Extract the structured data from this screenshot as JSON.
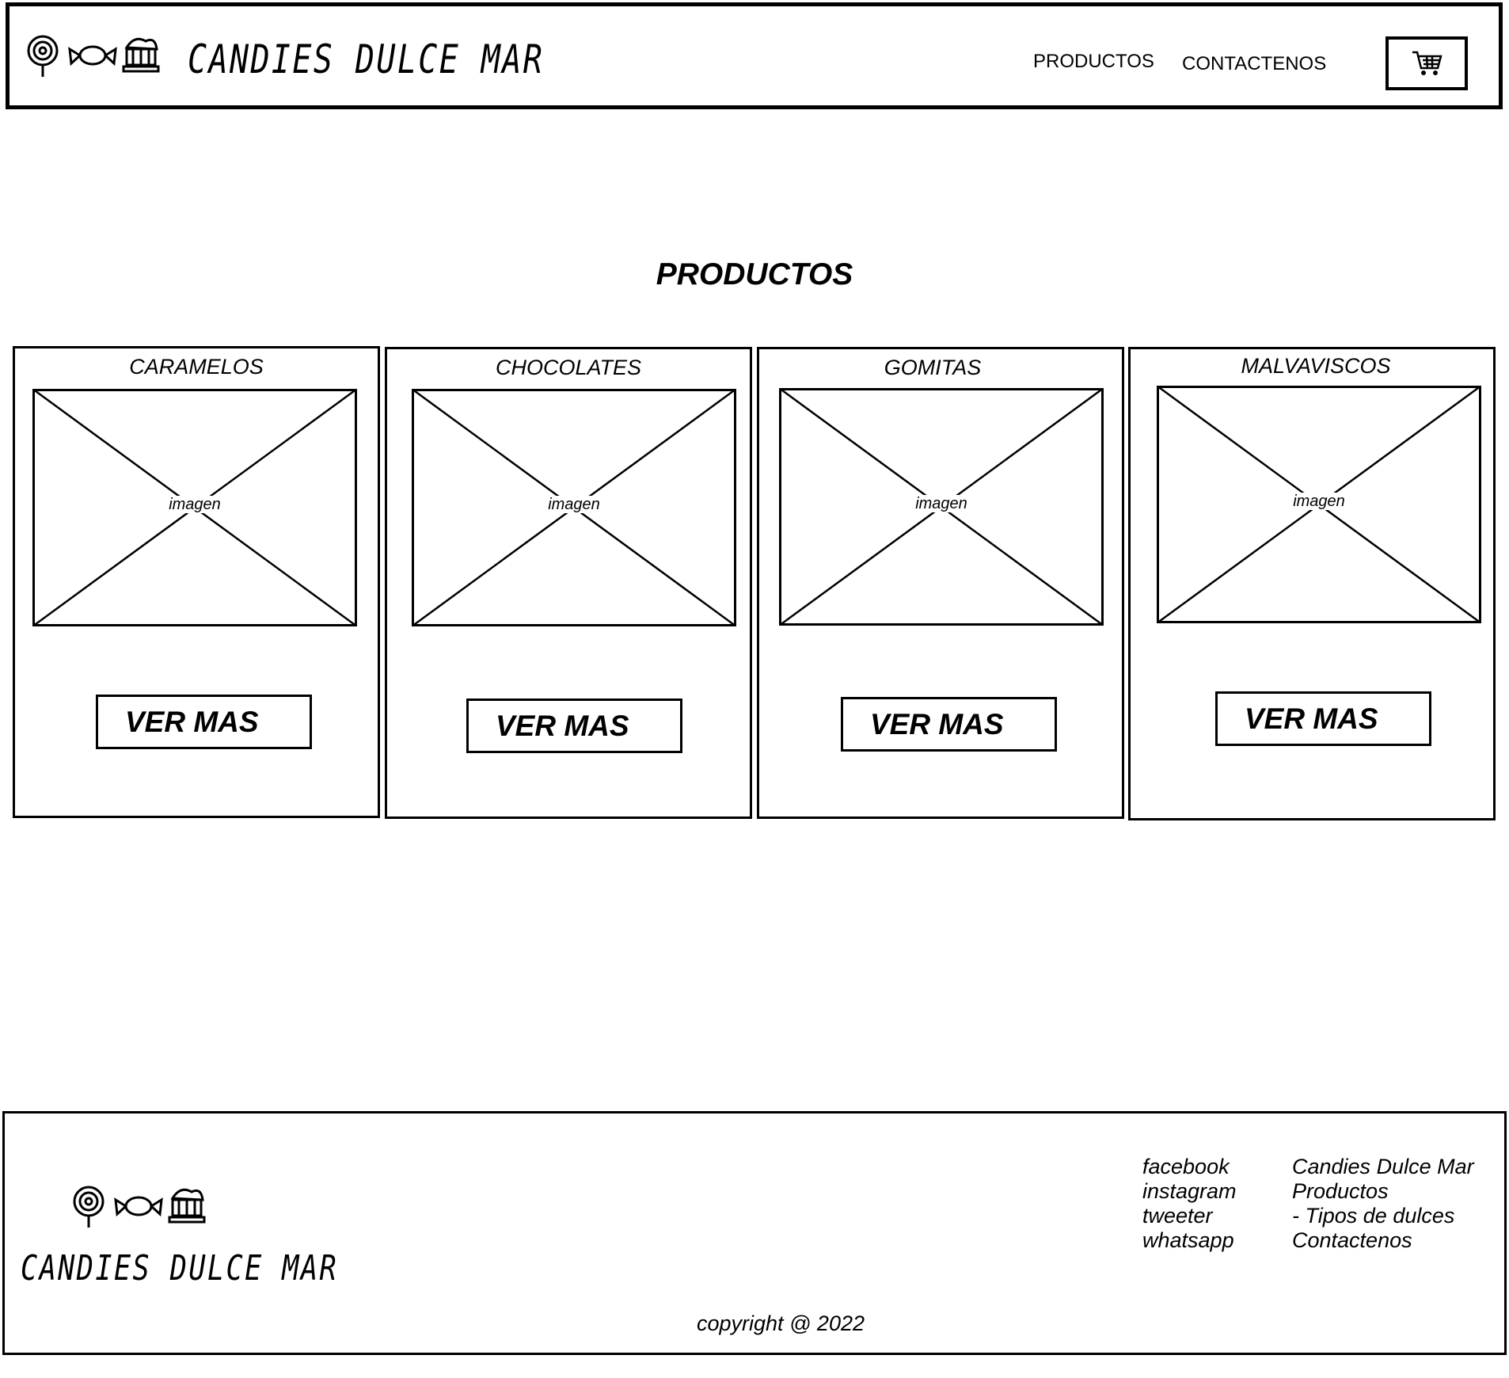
{
  "header": {
    "brand": "CANDIES DULCE MAR",
    "nav": [
      {
        "label": "PRODUCTOS"
      },
      {
        "label": "CONTACTENOS"
      }
    ],
    "cart_icon": "shopping-cart-icon"
  },
  "main": {
    "title": "PRODUCTOS",
    "cards": [
      {
        "title": "CARAMELOS",
        "image_label": "imagen",
        "button": "VER MAS"
      },
      {
        "title": "CHOCOLATES",
        "image_label": "imagen",
        "button": "VER MAS"
      },
      {
        "title": "GOMITAS",
        "image_label": "imagen",
        "button": "VER MAS"
      },
      {
        "title": "MALVAVISCOS",
        "image_label": "imagen",
        "button": "VER MAS"
      }
    ]
  },
  "footer": {
    "brand": "CANDIES DULCE MAR",
    "social": [
      "facebook",
      "instagram",
      "tweeter",
      "whatsapp"
    ],
    "links": [
      "Candies Dulce Mar",
      "Productos",
      "- Tipos de dulces",
      "Contactenos"
    ],
    "copyright": "copyright @ 2022"
  },
  "icons": [
    "lollipop-icon",
    "candy-icon",
    "ice-cream-icon",
    "shopping-cart-icon"
  ]
}
